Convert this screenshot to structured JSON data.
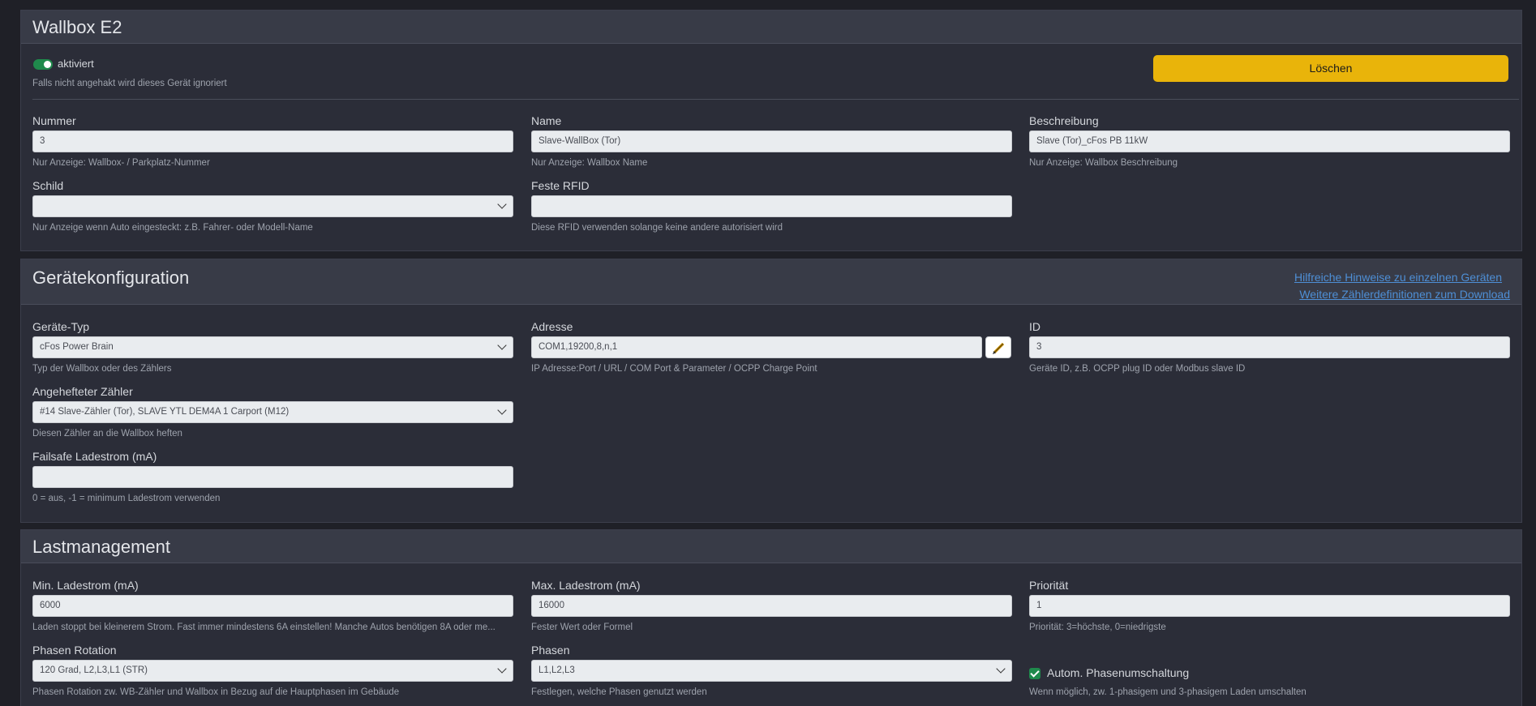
{
  "wallbox": {
    "title": "Wallbox E2",
    "enabled_label": "aktiviert",
    "enabled_help": "Falls nicht angehakt wird dieses Gerät ignoriert",
    "delete_label": "Löschen",
    "nummer": {
      "label": "Nummer",
      "value": "3",
      "help": "Nur Anzeige: Wallbox- / Parkplatz-Nummer"
    },
    "name": {
      "label": "Name",
      "value": "Slave-WallBox (Tor)",
      "help": "Nur Anzeige: Wallbox Name"
    },
    "beschreibung": {
      "label": "Beschreibung",
      "value": "Slave (Tor)_cFos PB 11kW",
      "help": "Nur Anzeige: Wallbox Beschreibung"
    },
    "schild": {
      "label": "Schild",
      "value": "",
      "help": "Nur Anzeige wenn Auto eingesteckt: z.B. Fahrer- oder Modell-Name"
    },
    "rfid": {
      "label": "Feste RFID",
      "value": "",
      "help": "Diese RFID verwenden solange keine andere autorisiert wird"
    }
  },
  "geraet": {
    "title": "Gerätekonfiguration",
    "link1": "Hilfreiche Hinweise zu einzelnen Geräten",
    "link2": "Weitere Zählerdefinitionen zum Download",
    "typ": {
      "label": "Geräte-Typ",
      "value": "cFos Power Brain",
      "help": "Typ der Wallbox oder des Zählers"
    },
    "adresse": {
      "label": "Adresse",
      "value": "COM1,19200,8,n,1",
      "help": "IP Adresse:Port / URL / COM Port & Parameter / OCPP Charge Point"
    },
    "id": {
      "label": "ID",
      "value": "3",
      "help": "Geräte ID, z.B. OCPP plug ID oder Modbus slave ID"
    },
    "zaehler": {
      "label": "Angehefteter Zähler",
      "value": "#14 Slave-Zähler (Tor), SLAVE YTL DEM4A 1 Carport (M12)",
      "help": "Diesen Zähler an die Wallbox heften"
    },
    "failsafe": {
      "label": "Failsafe Ladestrom (mA)",
      "value": "",
      "help": "0 = aus, -1 = minimum Ladestrom verwenden"
    }
  },
  "last": {
    "title": "Lastmanagement",
    "min": {
      "label": "Min. Ladestrom (mA)",
      "value": "6000",
      "help": "Laden stoppt bei kleinerem Strom. Fast immer mindestens 6A einstellen! Manche Autos benötigen 8A oder me..."
    },
    "max": {
      "label": "Max. Ladestrom (mA)",
      "value": "16000",
      "help": "Fester Wert oder Formel"
    },
    "prio": {
      "label": "Priorität",
      "value": "1",
      "help": "Priorität: 3=höchste, 0=niedrigste"
    },
    "rotation": {
      "label": "Phasen Rotation",
      "value": "120 Grad, L2,L3,L1 (STR)",
      "help": "Phasen Rotation zw. WB-Zähler und Wallbox in Bezug auf die Hauptphasen im Gebäude"
    },
    "phasen": {
      "label": "Phasen",
      "value": "L1,L2,L3",
      "help": "Festlegen, welche Phasen genutzt werden"
    },
    "auto_phase": {
      "label": "Autom. Phasenumschaltung",
      "help": "Wenn möglich, zw. 1-phasigem und 3-phasigem Laden umschalten"
    }
  },
  "colors": {
    "accent_green": "#1f8a4c",
    "delete_yellow": "#e9b40a",
    "link_blue": "#4e8fd6"
  },
  "icons": [
    "chevron-down-icon",
    "pencil-icon",
    "toggle-switch",
    "checkbox-checked"
  ]
}
